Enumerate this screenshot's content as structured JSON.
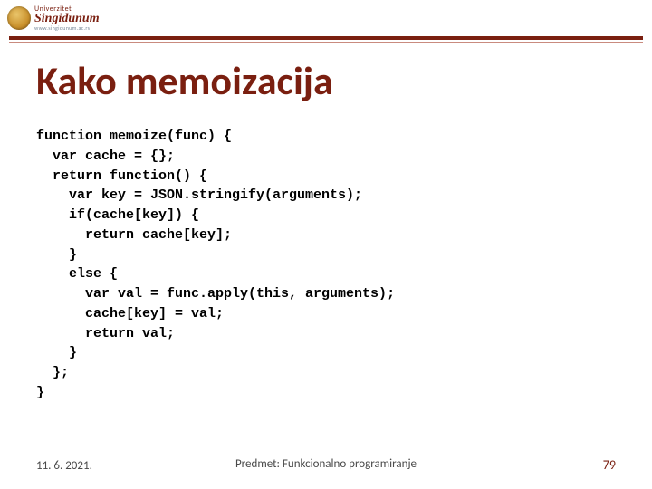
{
  "logo": {
    "top": "Univerzitet",
    "name": "Singidunum",
    "sub": "www.singidunum.ac.rs"
  },
  "title": "Kako memoizacija",
  "code": "function memoize(func) {\n  var cache = {};\n  return function() {\n    var key = JSON.stringify(arguments);\n    if(cache[key]) {\n      return cache[key];\n    }\n    else {\n      var val = func.apply(this, arguments);\n      cache[key] = val;\n      return val;\n    }\n  };\n}",
  "footer": {
    "date": "11. 6. 2021.",
    "subject": "Predmet: Funkcionalno programiranje",
    "page": "79"
  }
}
